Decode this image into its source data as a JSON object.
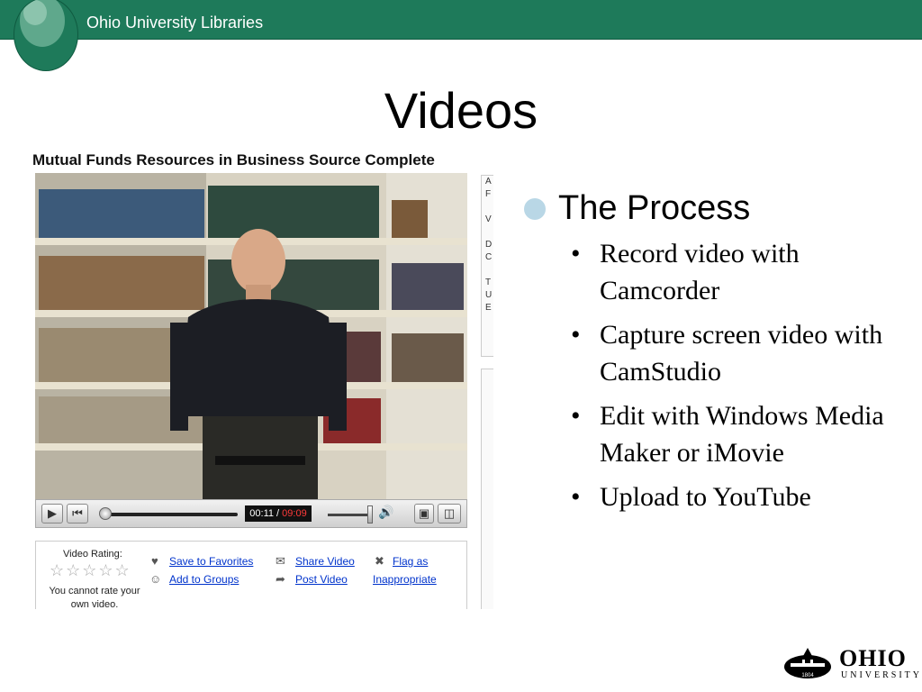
{
  "header": {
    "title": "Ohio University Libraries"
  },
  "slide": {
    "title": "Videos"
  },
  "video": {
    "heading": "Mutual Funds Resources in Business Source Complete",
    "time_current": "00:11",
    "time_separator": " / ",
    "time_total": "09:09",
    "rating_label": "Video Rating:",
    "rating_note": "You cannot rate your own video.",
    "actions": {
      "save_favorites": "Save to Favorites",
      "add_groups": "Add to Groups",
      "share_video": "Share Video",
      "post_video": "Post Video",
      "flag_as": "Flag as",
      "inappropriate": "Inappropriate"
    }
  },
  "bullets": {
    "heading": "The Process",
    "items": [
      "Record video with Camcorder",
      "Capture screen video with CamStudio",
      "Edit with Windows Media Maker or iMovie",
      "Upload to YouTube"
    ]
  },
  "footer_logo": {
    "name": "OHIO",
    "sub": "UNIVERSITY",
    "seal_text": "1804"
  },
  "colors": {
    "header_green": "#1e7a5a",
    "bullet_dot": "#b9d7e6",
    "link_blue": "#0033cc"
  }
}
